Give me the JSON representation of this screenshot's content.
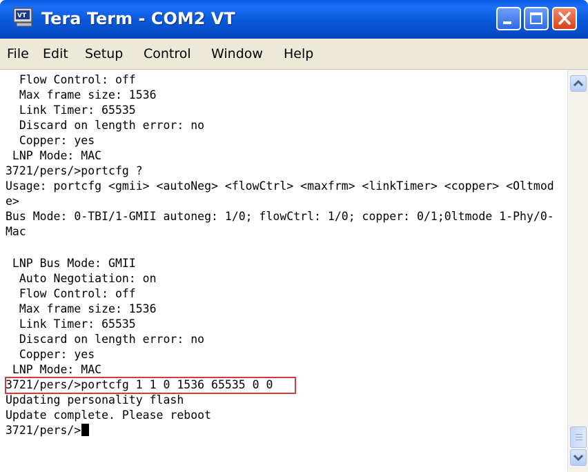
{
  "window": {
    "title": "Tera Term - COM2 VT",
    "icon": "teraterm-vt-icon",
    "controls": [
      "minimize-icon",
      "maximize-icon",
      "close-icon"
    ]
  },
  "menu": [
    "File",
    "Edit",
    "Setup",
    "Control",
    "Window",
    "Help"
  ],
  "terminal": {
    "lines": [
      "  Flow Control: off",
      "  Max frame size: 1536",
      "  Link Timer: 65535",
      "  Discard on length error: no",
      "  Copper: yes",
      " LNP Mode: MAC",
      "3721/pers/>portcfg ?",
      "Usage: portcfg <gmii> <autoNeg> <flowCtrl> <maxfrm> <linkTimer> <copper> <Oltmod",
      "e>",
      "Bus Mode: 0-TBI/1-GMII autoneg: 1/0; flowCtrl: 1/0; copper: 0/1;0ltmode 1-Phy/0-",
      "Mac",
      "",
      " LNP Bus Mode: GMII",
      "  Auto Negotiation: on",
      "  Flow Control: off",
      "  Max frame size: 1536",
      "  Link Timer: 65535",
      "  Discard on length error: no",
      "  Copper: yes",
      " LNP Mode: MAC",
      "3721/pers/>portcfg 1 1 0 1536 65535 0 0",
      "Updating personality flash",
      "Update complete. Please reboot"
    ],
    "prompt": "3721/pers/>"
  },
  "colors": {
    "titlebar": "#0a58d8",
    "menubar": "#ece9d8",
    "highlight": "#d03b3b"
  }
}
